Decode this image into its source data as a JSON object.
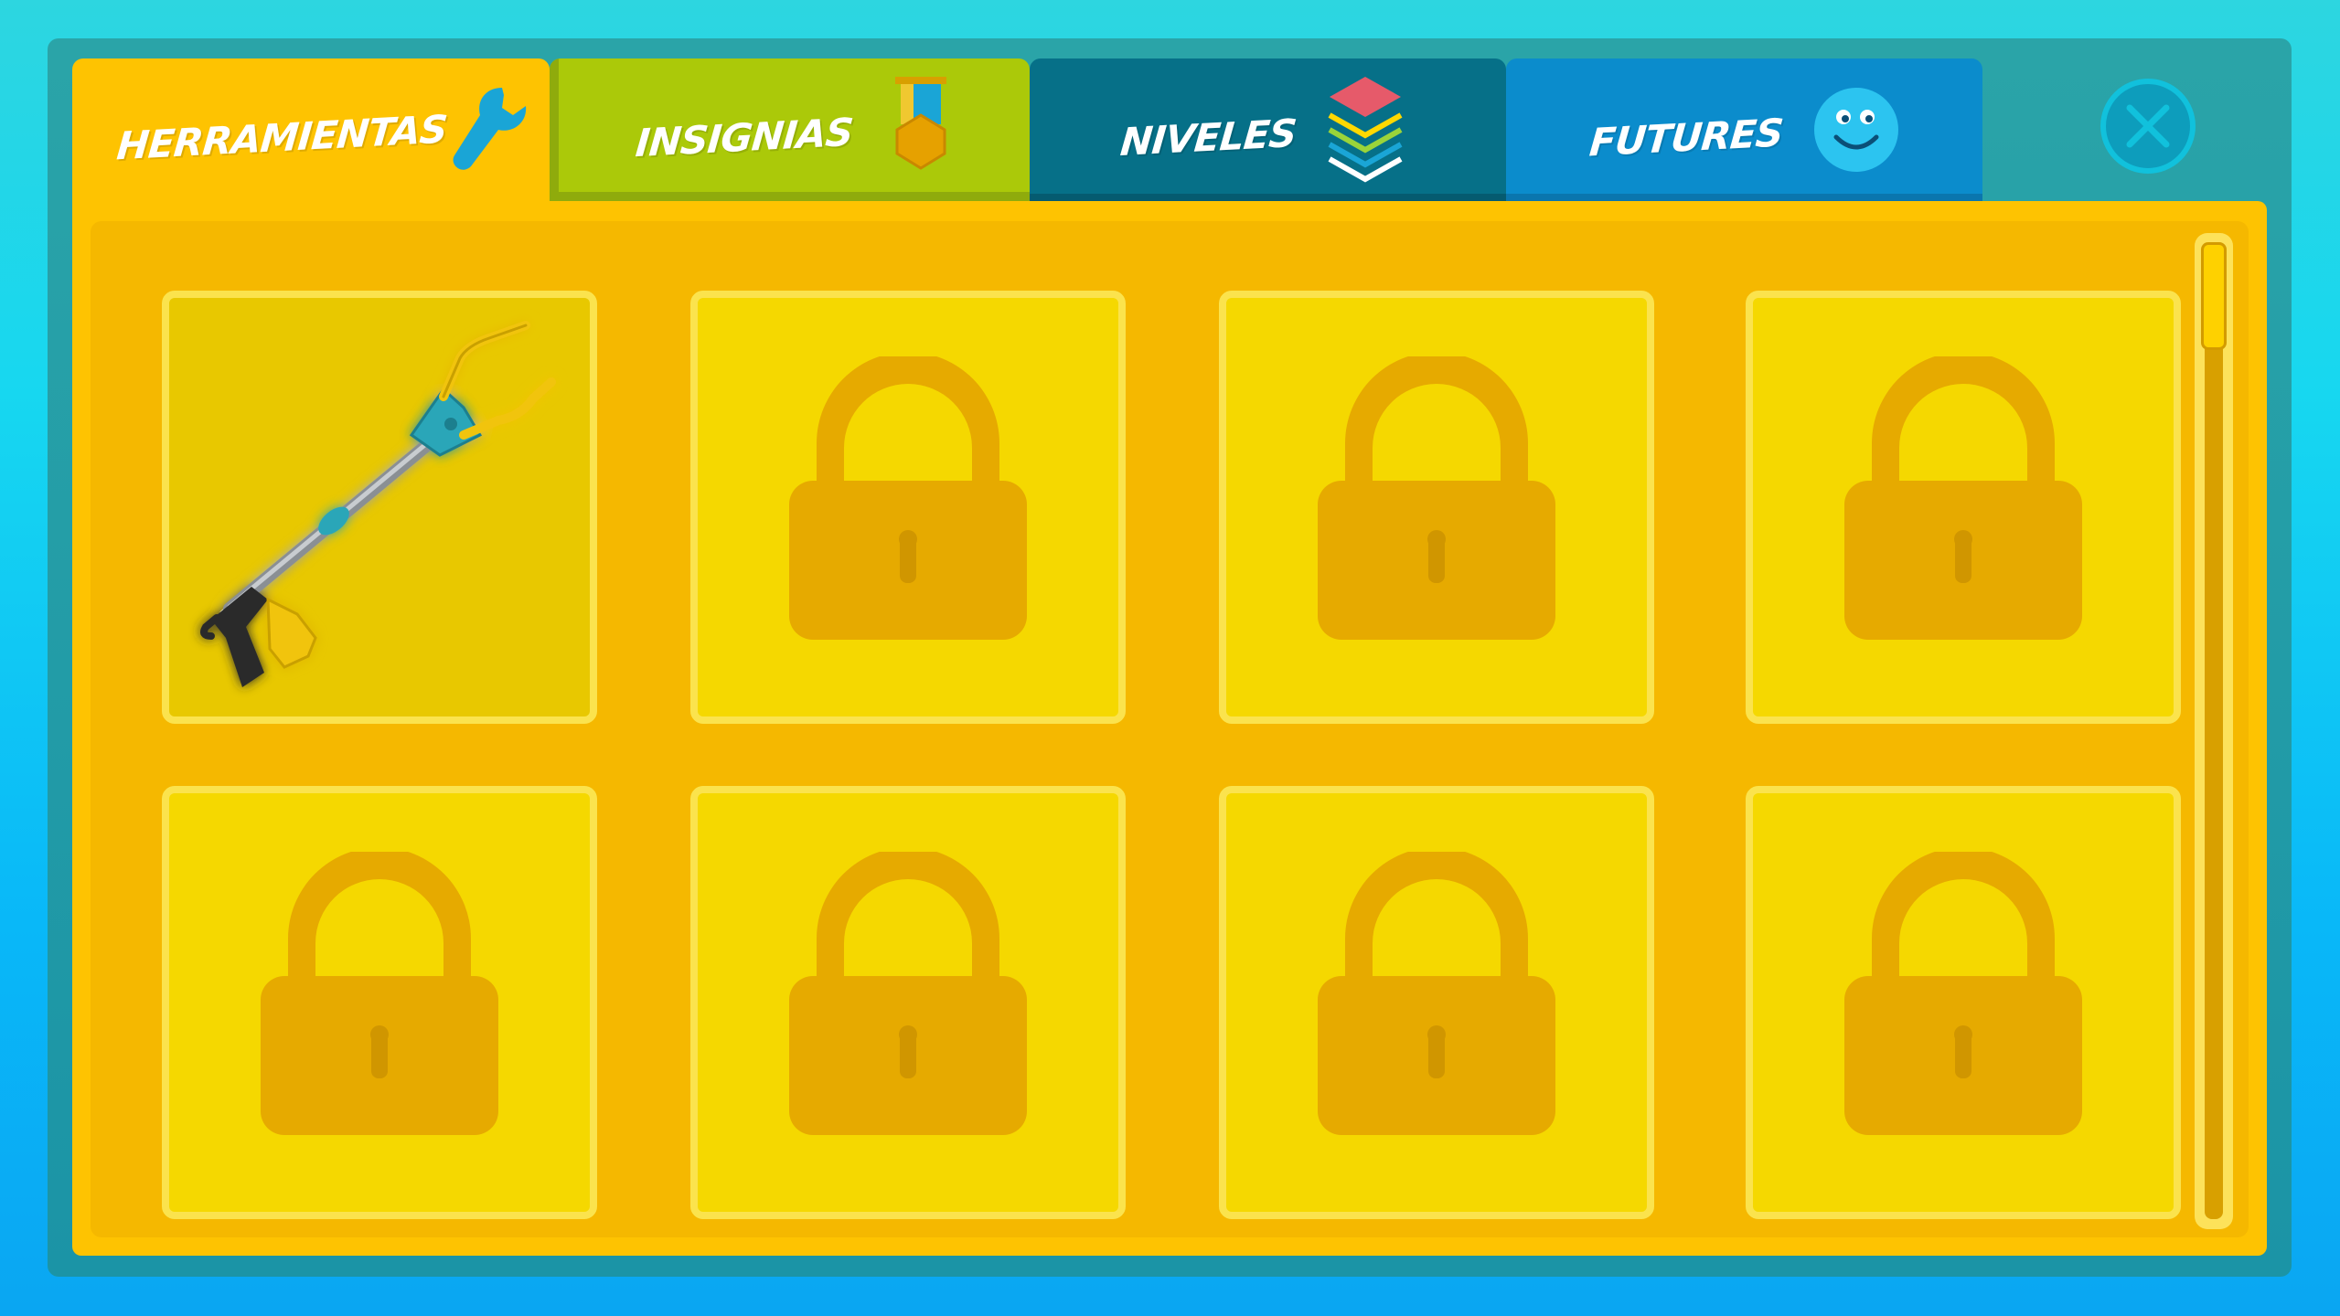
{
  "tabs": [
    {
      "label": "HERRAMIENTAS",
      "icon": "wrench-icon",
      "color": "#fec301",
      "active": true
    },
    {
      "label": "INSIGNIAS",
      "icon": "medal-icon",
      "color": "#abc909",
      "active": false
    },
    {
      "label": "NIVELES",
      "icon": "layers-icon",
      "color": "#067088",
      "active": false
    },
    {
      "label": "FUTURES",
      "icon": "smiley-icon",
      "color": "#0b8ccc",
      "active": false
    }
  ],
  "close_icon": "close-icon",
  "slots": [
    {
      "state": "unlocked",
      "item": "trash-grabber-tool"
    },
    {
      "state": "locked",
      "icon": "lock-icon"
    },
    {
      "state": "locked",
      "icon": "lock-icon"
    },
    {
      "state": "locked",
      "icon": "lock-icon"
    },
    {
      "state": "locked",
      "icon": "lock-icon"
    },
    {
      "state": "locked",
      "icon": "lock-icon"
    },
    {
      "state": "locked",
      "icon": "lock-icon"
    },
    {
      "state": "locked",
      "icon": "lock-icon"
    }
  ],
  "colors": {
    "panel": "#fec301",
    "slot": "#f5d800",
    "lock": "#e5a900",
    "background": "#17d7f0"
  }
}
